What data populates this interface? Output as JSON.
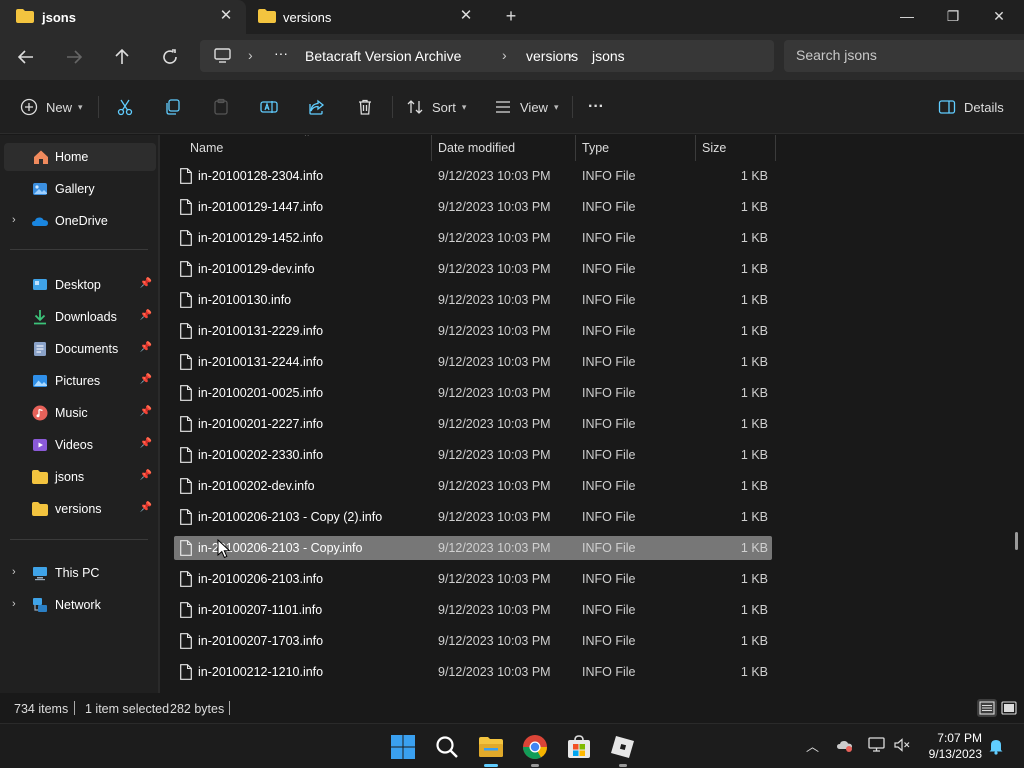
{
  "tabs": [
    {
      "label": "jsons",
      "active": true
    },
    {
      "label": "versions",
      "active": false
    }
  ],
  "window": {
    "new_tab": "+",
    "minimize": "—",
    "maximize": "❐",
    "close": "✕"
  },
  "breadcrumb": {
    "more": "···",
    "items": [
      "Betacraft Version Archive",
      "versions",
      "jsons"
    ]
  },
  "search": {
    "placeholder": "Search jsons"
  },
  "toolbar": {
    "new_label": "New",
    "sort_label": "Sort",
    "view_label": "View",
    "more_label": "···",
    "details_label": "Details"
  },
  "sidebar": {
    "top": [
      {
        "label": "Home",
        "icon": "home-icon",
        "expandable": false,
        "selected": true
      },
      {
        "label": "Gallery",
        "icon": "gallery-icon",
        "expandable": false
      },
      {
        "label": "OneDrive",
        "icon": "onedrive-icon",
        "expandable": true
      }
    ],
    "quick": [
      {
        "label": "Desktop",
        "icon": "desktop-icon"
      },
      {
        "label": "Downloads",
        "icon": "downloads-icon"
      },
      {
        "label": "Documents",
        "icon": "documents-icon"
      },
      {
        "label": "Pictures",
        "icon": "pictures-icon"
      },
      {
        "label": "Music",
        "icon": "music-icon"
      },
      {
        "label": "Videos",
        "icon": "videos-icon"
      },
      {
        "label": "jsons",
        "icon": "folder-icon"
      },
      {
        "label": "versions",
        "icon": "folder-icon"
      }
    ],
    "bottom": [
      {
        "label": "This PC",
        "icon": "pc-icon"
      },
      {
        "label": "Network",
        "icon": "network-icon"
      }
    ]
  },
  "columns": {
    "name": "Name",
    "date": "Date modified",
    "type": "Type",
    "size": "Size"
  },
  "files": [
    {
      "name": "in-20100128-2304.info",
      "date": "9/12/2023 10:03 PM",
      "type": "INFO File",
      "size": "1 KB"
    },
    {
      "name": "in-20100129-1447.info",
      "date": "9/12/2023 10:03 PM",
      "type": "INFO File",
      "size": "1 KB"
    },
    {
      "name": "in-20100129-1452.info",
      "date": "9/12/2023 10:03 PM",
      "type": "INFO File",
      "size": "1 KB"
    },
    {
      "name": "in-20100129-dev.info",
      "date": "9/12/2023 10:03 PM",
      "type": "INFO File",
      "size": "1 KB"
    },
    {
      "name": "in-20100130.info",
      "date": "9/12/2023 10:03 PM",
      "type": "INFO File",
      "size": "1 KB"
    },
    {
      "name": "in-20100131-2229.info",
      "date": "9/12/2023 10:03 PM",
      "type": "INFO File",
      "size": "1 KB"
    },
    {
      "name": "in-20100131-2244.info",
      "date": "9/12/2023 10:03 PM",
      "type": "INFO File",
      "size": "1 KB"
    },
    {
      "name": "in-20100201-0025.info",
      "date": "9/12/2023 10:03 PM",
      "type": "INFO File",
      "size": "1 KB"
    },
    {
      "name": "in-20100201-2227.info",
      "date": "9/12/2023 10:03 PM",
      "type": "INFO File",
      "size": "1 KB"
    },
    {
      "name": "in-20100202-2330.info",
      "date": "9/12/2023 10:03 PM",
      "type": "INFO File",
      "size": "1 KB"
    },
    {
      "name": "in-20100202-dev.info",
      "date": "9/12/2023 10:03 PM",
      "type": "INFO File",
      "size": "1 KB"
    },
    {
      "name": "in-20100206-2103 - Copy (2).info",
      "date": "9/12/2023 10:03 PM",
      "type": "INFO File",
      "size": "1 KB"
    },
    {
      "name": "in-20100206-2103 - Copy.info",
      "date": "9/12/2023 10:03 PM",
      "type": "INFO File",
      "size": "1 KB",
      "selected": true
    },
    {
      "name": "in-20100206-2103.info",
      "date": "9/12/2023 10:03 PM",
      "type": "INFO File",
      "size": "1 KB"
    },
    {
      "name": "in-20100207-1101.info",
      "date": "9/12/2023 10:03 PM",
      "type": "INFO File",
      "size": "1 KB"
    },
    {
      "name": "in-20100207-1703.info",
      "date": "9/12/2023 10:03 PM",
      "type": "INFO File",
      "size": "1 KB"
    },
    {
      "name": "in-20100212-1210.info",
      "date": "9/12/2023 10:03 PM",
      "type": "INFO File",
      "size": "1 KB"
    }
  ],
  "status": {
    "items": "734 items",
    "selected": "1 item selected",
    "bytes": "282 bytes"
  },
  "taskbar": {
    "time": "7:07 PM",
    "date": "9/13/2023"
  },
  "colors": {
    "accent": "#60cdff",
    "folder": "#f3c43f",
    "selection": "#777777",
    "onedrive": "#0f78d4"
  }
}
